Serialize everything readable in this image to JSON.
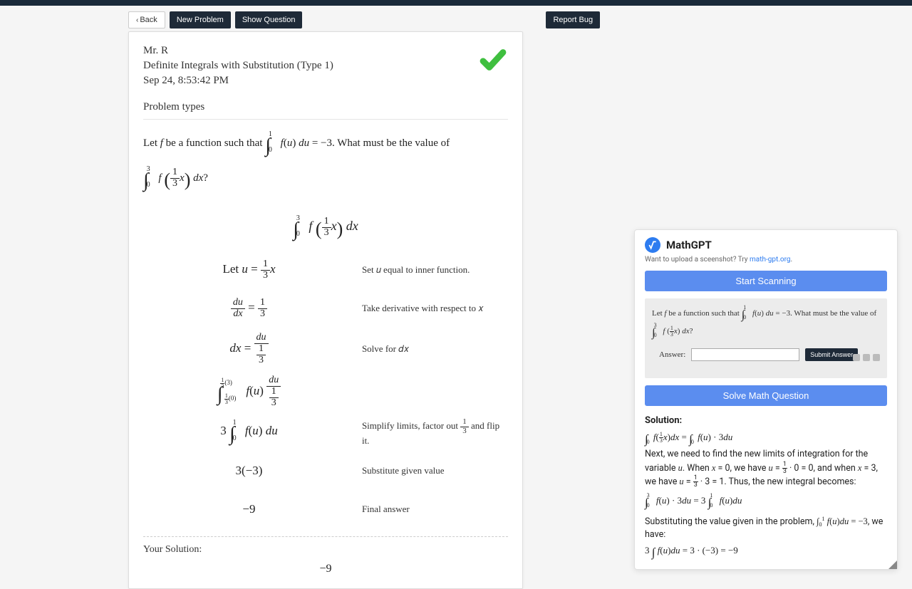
{
  "toolbar": {
    "back": "Back",
    "new_problem": "New Problem",
    "show_question": "Show Question",
    "report_bug": "Report Bug"
  },
  "card": {
    "teacher": "Mr. R",
    "topic": "Definite Integrals with Substitution (Type 1)",
    "date": "Sep 24, 8:53:42 PM",
    "problem_types": "Problem types",
    "question_1": "Let ",
    "question_2": " be a function such that ",
    "question_3": ". What must be the value of",
    "given_value": "−3",
    "steps": {
      "s1_expl": "Set 𝑢 equal to inner function.",
      "s2_expl": "Take derivative with respect to 𝑥",
      "s3_expl": "Solve for 𝑑𝑥",
      "s4_expl": "",
      "s5_expl_a": "Simplify limits, factor out ",
      "s5_expl_b": " and flip it.",
      "s6_expl": "Substitute given value",
      "s7_expl": "Final answer",
      "s6_math": "3(−3)",
      "s7_math": "−9"
    },
    "your_solution_label": "Your Solution:",
    "your_solution": "−9"
  },
  "panel": {
    "title": "MathGPT",
    "subtitle_a": "Want to upload a sceenshot? Try ",
    "subtitle_link": "math-gpt.org",
    "subtitle_b": ".",
    "start_scanning": "Start Scanning",
    "answer_label": "Answer:",
    "submit": "Submit Answer",
    "solve_btn": "Solve Math Question",
    "solution_heading": "Solution:",
    "sol_line2": "Next, we need to find the new limits of integration for the variable ",
    "sol_line2b": ". When ",
    "sol_line2c": ", we have ",
    "sol_line2d": ", and when ",
    "sol_line2e": ", we have ",
    "sol_line2f": ". Thus, the new integral becomes:",
    "sol_line4": "Substituting the value given in the problem, ",
    "sol_line4b": ", we have:"
  }
}
